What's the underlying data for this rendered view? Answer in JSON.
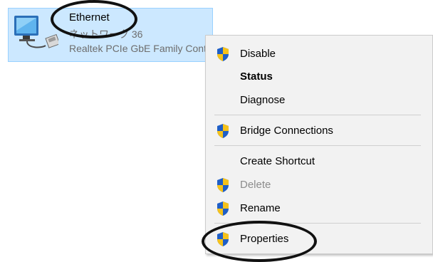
{
  "adapter": {
    "name": "Ethernet",
    "network": "ネットワーク 36",
    "device": "Realtek PCIe GbE Family Controller"
  },
  "menu": {
    "items": [
      {
        "label": "Disable",
        "shield": true,
        "bold": false,
        "enabled": true
      },
      {
        "label": "Status",
        "shield": false,
        "bold": true,
        "enabled": true
      },
      {
        "label": "Diagnose",
        "shield": false,
        "bold": false,
        "enabled": true
      },
      {
        "label": "Bridge Connections",
        "shield": true,
        "bold": false,
        "enabled": true
      },
      {
        "label": "Create Shortcut",
        "shield": false,
        "bold": false,
        "enabled": true
      },
      {
        "label": "Delete",
        "shield": true,
        "bold": false,
        "enabled": false
      },
      {
        "label": "Rename",
        "shield": true,
        "bold": false,
        "enabled": true
      },
      {
        "label": "Properties",
        "shield": true,
        "bold": false,
        "enabled": true
      }
    ]
  },
  "colors": {
    "selection_bg": "#cce8ff",
    "menu_bg": "#f2f2f2",
    "shield_blue": "#1f5fc7",
    "shield_yellow": "#f6c21a"
  },
  "icons": {
    "adapter": "network-adapter-icon",
    "uac": "uac-shield-icon"
  }
}
